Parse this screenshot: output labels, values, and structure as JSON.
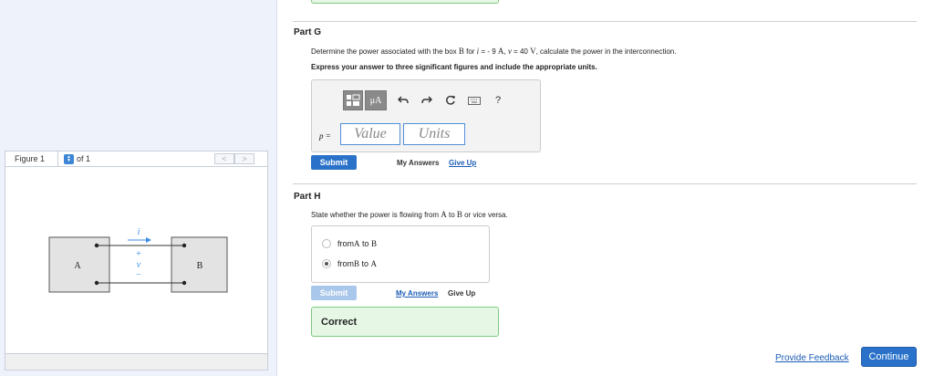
{
  "figure": {
    "label": "Figure 1",
    "of": "of 1",
    "prev": "<",
    "next": ">",
    "box_a": "A",
    "box_b": "B",
    "current_label": "i",
    "plus": "+",
    "voltage_label": "v",
    "minus": "−"
  },
  "part_g": {
    "title": "Part G",
    "prompt_pre": "Determine the power associated with the box ",
    "prompt_box": "B",
    "prompt_mid1": " for ",
    "prompt_i": "i",
    "prompt_mid2": " = - 9 ",
    "prompt_amp": "A",
    "prompt_mid3": ", ",
    "prompt_v": "v",
    "prompt_mid4": " = 40 ",
    "prompt_volt": "V",
    "prompt_post": ", calculate the power in the interconnection.",
    "instruction": "Express your answer to three significant figures and include the appropriate units.",
    "toolbar": {
      "templates_icon": "templates-icon",
      "units_label": "μA",
      "help": "?"
    },
    "p_label": "p =",
    "value_placeholder": "Value",
    "units_placeholder": "Units",
    "submit": "Submit",
    "my_answers": "My Answers",
    "give_up": "Give Up"
  },
  "part_h": {
    "title": "Part H",
    "prompt_pre": "State whether the power is flowing from ",
    "prompt_a": "A",
    "prompt_mid": " to ",
    "prompt_b": "B",
    "prompt_post": " or vice versa.",
    "options": [
      {
        "pre": "from ",
        "a": "A",
        "mid": " to ",
        "b": "B",
        "selected": false
      },
      {
        "pre": "from ",
        "a": "B",
        "mid": " to ",
        "b": "A",
        "selected": true
      }
    ],
    "submit": "Submit",
    "my_answers": "My Answers",
    "give_up": "Give Up",
    "feedback": "Correct"
  },
  "footer": {
    "provide_feedback": "Provide Feedback",
    "continue": "Continue"
  },
  "colors": {
    "accent": "#2a72c9",
    "correct_bg": "#e6f7e6",
    "correct_border": "#7fc97f",
    "link": "#1b5cb5"
  }
}
